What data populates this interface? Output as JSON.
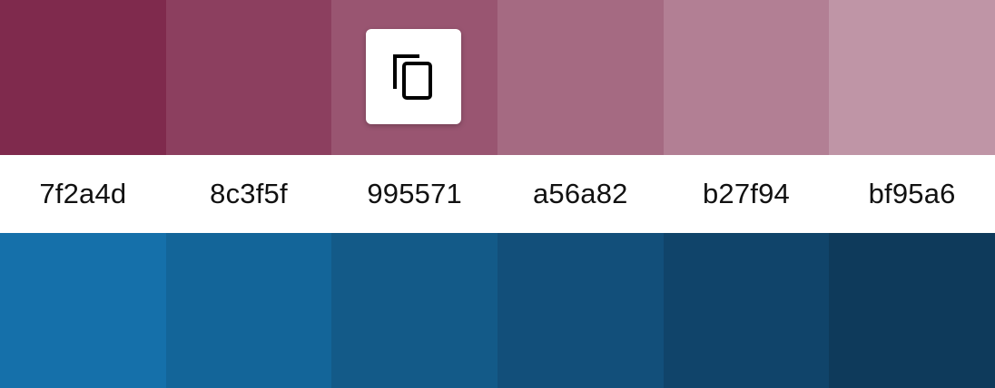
{
  "palettes": {
    "top": {
      "swatches": [
        {
          "hex": "7f2a4d",
          "color": "#7f2a4d"
        },
        {
          "hex": "8c3f5f",
          "color": "#8c3f5f"
        },
        {
          "hex": "995571",
          "color": "#995571"
        },
        {
          "hex": "a56a82",
          "color": "#a56a82"
        },
        {
          "hex": "b27f94",
          "color": "#b27f94"
        },
        {
          "hex": "bf95a6",
          "color": "#bf95a6"
        }
      ]
    },
    "bottom": {
      "swatches": [
        {
          "color": "#1570aa"
        },
        {
          "color": "#136599"
        },
        {
          "color": "#135a88"
        },
        {
          "color": "#124f7a"
        },
        {
          "color": "#10446a"
        },
        {
          "color": "#0e3a5b"
        }
      ]
    }
  },
  "copy_button": {
    "icon": "copy-icon"
  }
}
